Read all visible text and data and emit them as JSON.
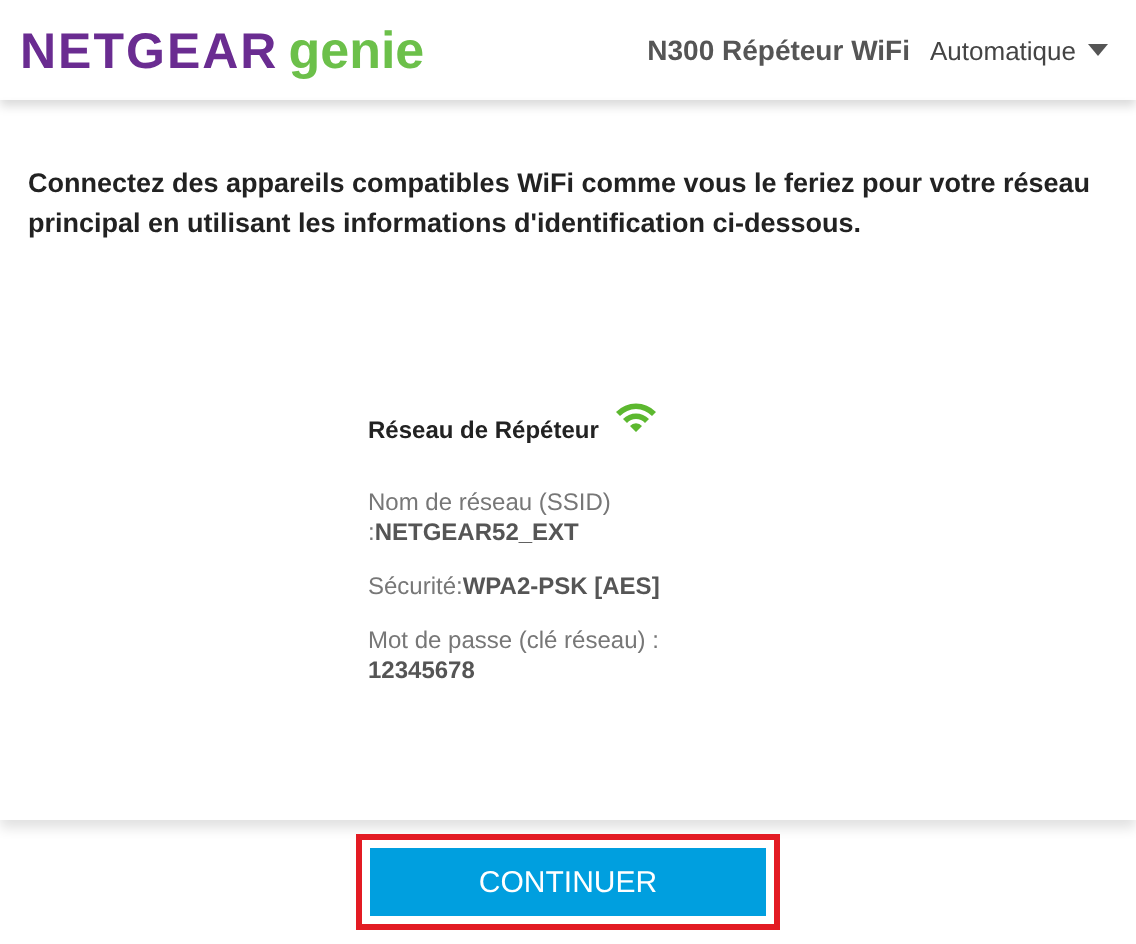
{
  "header": {
    "logo_brand": "NETGEAR",
    "logo_product": "genie",
    "product": "N300 Répéteur WiFi",
    "language": "Automatique"
  },
  "intro": "Connectez des appareils compatibles WiFi comme vous le feriez pour votre réseau principal en utilisant les informations d'identification ci-dessous.",
  "network": {
    "title": "Réseau de Répéteur",
    "fields": [
      {
        "label": "Nom de réseau (SSID) :",
        "value": "NETGEAR52_EXT"
      },
      {
        "label": "Sécurité:",
        "value": "WPA2-PSK [AES]"
      },
      {
        "label": "Mot de passe (clé réseau) :",
        "value": "12345678"
      }
    ]
  },
  "continue_button": {
    "label": "CONTINUER",
    "highlighted": true
  }
}
